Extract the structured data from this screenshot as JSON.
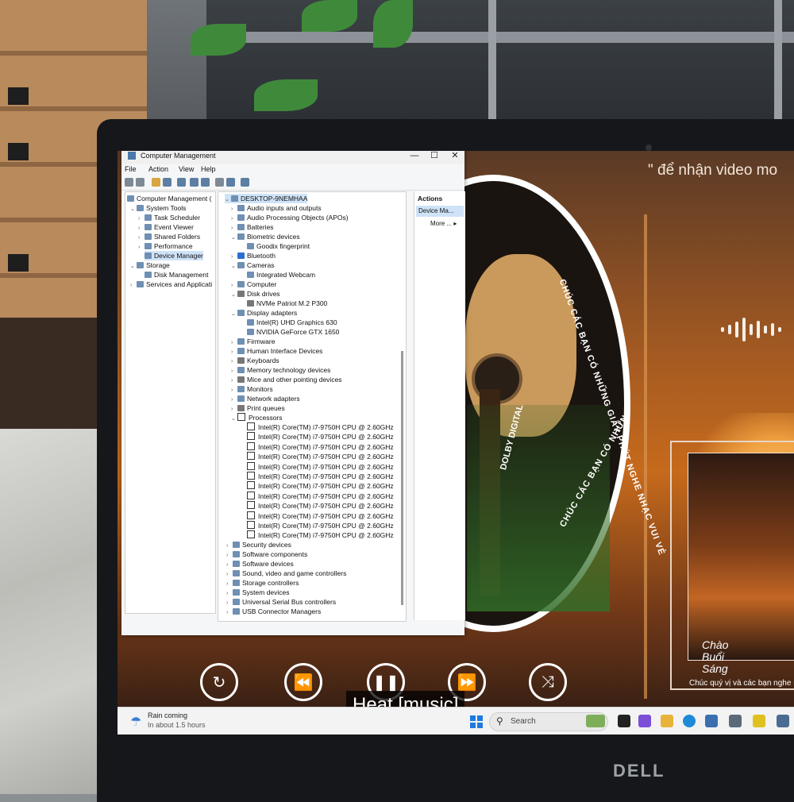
{
  "window": {
    "title": "Computer Management",
    "menu": [
      "File",
      "Action",
      "View",
      "Help"
    ]
  },
  "tree": {
    "root": "Computer Management (",
    "items": [
      "System Tools",
      "Task Scheduler",
      "Event Viewer",
      "Shared Folders",
      "Performance",
      "Device Manager",
      "Storage",
      "Disk Management",
      "Services and Applicati"
    ]
  },
  "devices": {
    "root": "DESKTOP-9NEMHAA",
    "categories": [
      "Audio inputs and outputs",
      "Audio Processing Objects (APOs)",
      "Batteries",
      "Biometric devices",
      "Goodix fingerprint",
      "Bluetooth",
      "Cameras",
      "Integrated Webcam",
      "Computer",
      "Disk drives",
      "NVMe Patriot M.2 P300",
      "Display adapters",
      "Intel(R) UHD Graphics 630",
      "NVIDIA GeForce GTX 1650",
      "Firmware",
      "Human Interface Devices",
      "Keyboards",
      "Memory technology devices",
      "Mice and other pointing devices",
      "Monitors",
      "Network adapters",
      "Print queues",
      "Processors"
    ],
    "processor_label": "Intel(R) Core(TM) i7-9750H CPU @ 2.60GHz",
    "processor_count": 12,
    "after": [
      "Security devices",
      "Software components",
      "Software devices",
      "Sound, video and game controllers",
      "Storage controllers",
      "System devices",
      "Universal Serial Bus controllers",
      "USB Connector Managers"
    ]
  },
  "actions": {
    "header": "Actions",
    "selected": "Device Ma...",
    "more": "More ..."
  },
  "video": {
    "top_caption": "\" để nhận video mo",
    "disc_text_1": "CHÚC CÁC BẠN CÓ NHỮNG GIÂY PHÚT NGHE NHẠC VUI VẺ",
    "disc_text_2": "CHÚC CÁC BẠN CÓ NHỮN",
    "dolby": "DOLBY DIGITAL",
    "thumb_brand": "Chào Buổi Sáng",
    "thumb_caption": "Chúc quý vị và các bạn nghe nhạ",
    "subtitle": "Heat [music]"
  },
  "taskbar": {
    "weather_line1": "Rain coming",
    "weather_line2": "In about 1.5 hours",
    "search_placeholder": "Search"
  },
  "laptop_brand": "DELL",
  "colors": {
    "selection": "#cfe3f7",
    "start_blue": "#1f7ae0",
    "sunset_orange": "#c66a1c"
  }
}
